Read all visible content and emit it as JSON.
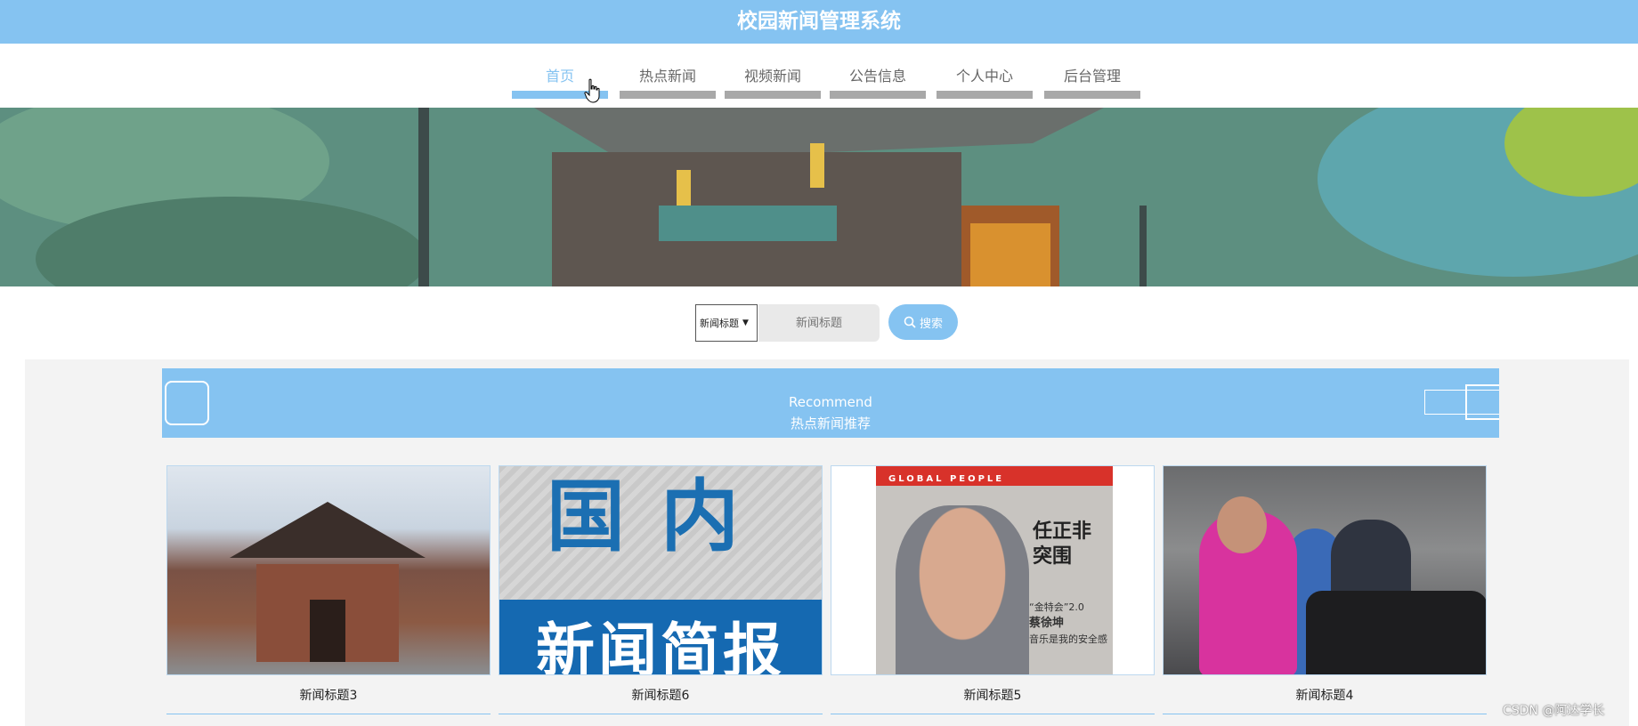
{
  "app": {
    "title": "校园新闻管理系统"
  },
  "nav": {
    "items": [
      {
        "label": "首页",
        "active": true
      },
      {
        "label": "热点新闻",
        "active": false
      },
      {
        "label": "视频新闻",
        "active": false
      },
      {
        "label": "公告信息",
        "active": false
      },
      {
        "label": "个人中心",
        "active": false
      },
      {
        "label": "后台管理",
        "active": false
      }
    ]
  },
  "search": {
    "select_value": "新闻标题",
    "placeholder": "新闻标题",
    "button_label": "搜索"
  },
  "recommend": {
    "title_en": "Recommend",
    "title_cn": "热点新闻推荐"
  },
  "cards": [
    {
      "title": "新闻标题3",
      "image": "temple-photo"
    },
    {
      "title": "新闻标题6",
      "image": "news-briefing-cover"
    },
    {
      "title": "新闻标题5",
      "image": "magazine-cover"
    },
    {
      "title": "新闻标题4",
      "image": "gym-photo"
    }
  ],
  "magazine": {
    "masthead": "GLOBAL PEOPLE",
    "headline_1": "任正非",
    "headline_2": "突围",
    "sub_1": "“金特会”2.0",
    "sub_2": "蔡徐坤",
    "sub_3": "音乐是我的安全感"
  },
  "news_cover": {
    "top": "国内",
    "bar": "新闻简报"
  },
  "watermark": "CSDN @阿达学长",
  "colors": {
    "accent": "#85c3f1",
    "inactive_bar": "#a8a8a8",
    "panel_bg": "#f3f3f3"
  }
}
